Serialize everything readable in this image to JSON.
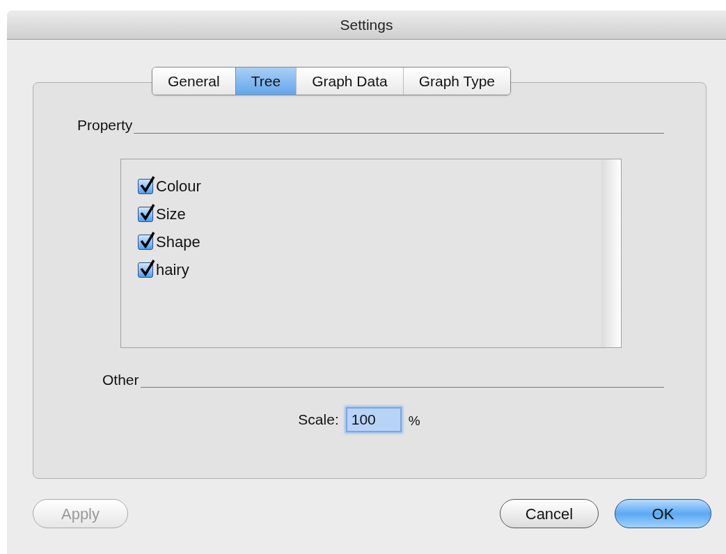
{
  "window": {
    "title": "Settings"
  },
  "tabs": [
    {
      "label": "General",
      "selected": false
    },
    {
      "label": "Tree",
      "selected": true
    },
    {
      "label": "Graph Data",
      "selected": false
    },
    {
      "label": "Graph Type",
      "selected": false
    }
  ],
  "property": {
    "heading": "Property",
    "items": [
      {
        "label": "Colour",
        "checked": true
      },
      {
        "label": "Size",
        "checked": true
      },
      {
        "label": "Shape",
        "checked": true
      },
      {
        "label": "hairy",
        "checked": true
      }
    ]
  },
  "other": {
    "heading": "Other",
    "scale_label": "Scale:",
    "scale_value": "100",
    "unit": "%"
  },
  "buttons": [
    {
      "label": "Apply",
      "disabled": true,
      "default": false
    },
    {
      "label": "Cancel",
      "disabled": false,
      "default": false
    },
    {
      "label": "OK",
      "disabled": false,
      "default": true
    }
  ]
}
